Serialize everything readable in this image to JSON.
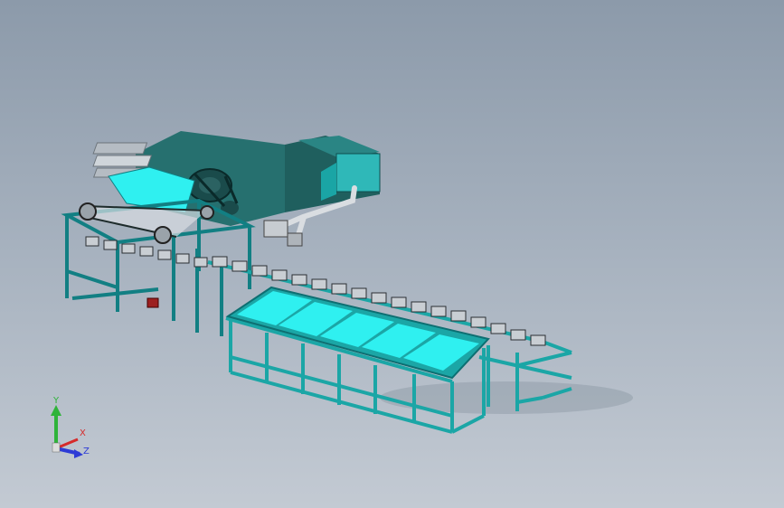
{
  "viewport": {
    "background_top": "#8c9aaa",
    "background_bottom": "#c3cad3"
  },
  "model": {
    "frame_color": "#1fb5b5",
    "frame_dark": "#127f83",
    "panel_color": "#2ff0f0",
    "housing_color": "#26706f",
    "steel_color": "#b5bcc3"
  },
  "triad": {
    "x_label": "X",
    "y_label": "Y",
    "z_label": "Z",
    "x_color": "#d62b2b",
    "y_color": "#2fb33a",
    "z_color": "#2d3bd6"
  }
}
